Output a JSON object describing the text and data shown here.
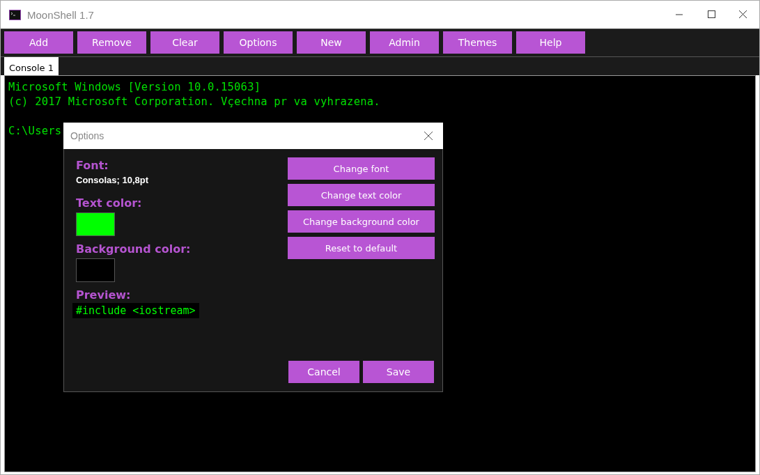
{
  "window": {
    "title": "MoonShell 1.7"
  },
  "toolbar": [
    "Add",
    "Remove",
    "Clear",
    "Options",
    "New",
    "Admin",
    "Themes",
    "Help"
  ],
  "tabs": [
    {
      "label": "Console 1",
      "selected": true
    }
  ],
  "console": {
    "lines": [
      "Microsoft Windows [Version 10.0.15063]",
      "(c) 2017 Microsoft Corporation. Vçechna pr va vyhrazena."
    ],
    "prompt": "C:\\Users"
  },
  "dialog": {
    "title": "Options",
    "font_label": "Font:",
    "font_value": "Consolas; 10,8pt",
    "swatches": [
      {
        "label": "Text color:",
        "color": "#00ff00"
      },
      {
        "label": "Background color:",
        "color": "#000000"
      }
    ],
    "preview_label": "Preview:",
    "preview_text": "#include <iostream>",
    "actions": [
      "Change font",
      "Change text color",
      "Change background color",
      "Reset to default"
    ],
    "buttons": [
      "Cancel",
      "Save"
    ]
  }
}
